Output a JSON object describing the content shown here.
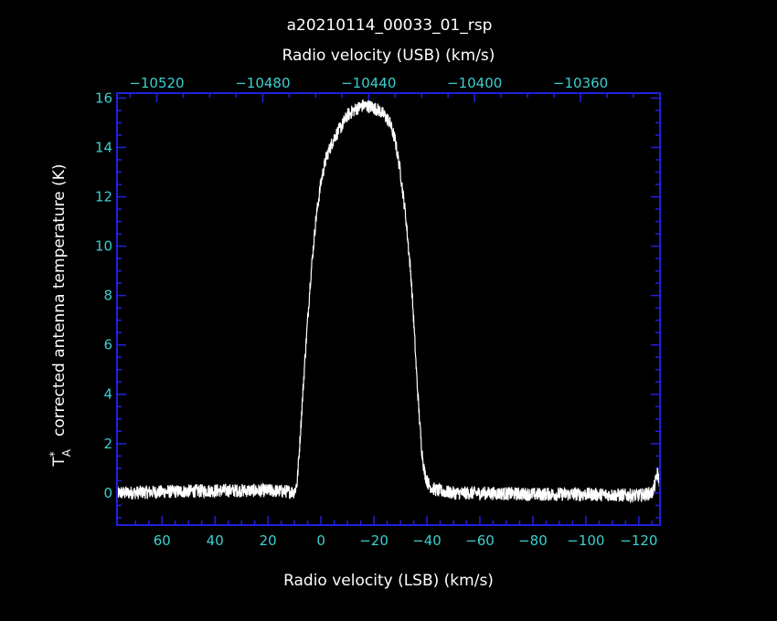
{
  "chart_data": {
    "type": "line",
    "title": "a20210114_00033_01_rsp",
    "top_axis_label": "Radio velocity (USB) (km/s)",
    "xlabel": "Radio velocity (LSB) (km/s)",
    "ylabel": "corrected antenna temperature (K)",
    "ylabel_symbol": "T",
    "ylabel_superscript": "*",
    "ylabel_subscript": "A",
    "xlim": [
      77,
      -128
    ],
    "ylim": [
      -1.3,
      16.2
    ],
    "top_xlim": [
      -10535,
      -10330
    ],
    "x_ticks": [
      60,
      40,
      20,
      0,
      -20,
      -40,
      -60,
      -80,
      -100,
      -120
    ],
    "x_tick_labels": [
      "60",
      "40",
      "20",
      "0",
      "−20",
      "−40",
      "−60",
      "−80",
      "−100",
      "−120"
    ],
    "top_x_ticks": [
      -10520,
      -10480,
      -10440,
      -10400,
      -10360
    ],
    "top_x_tick_labels": [
      "−10520",
      "−10480",
      "−10440",
      "−10400",
      "−10360"
    ],
    "y_ticks": [
      0,
      2,
      4,
      6,
      8,
      10,
      12,
      14,
      16
    ],
    "y_tick_labels": [
      "0",
      "2",
      "4",
      "6",
      "8",
      "10",
      "12",
      "14",
      "16"
    ],
    "grid": false,
    "series": [
      {
        "x": [
          77,
          60,
          40,
          20,
          10,
          9,
          8,
          6,
          4,
          2,
          0,
          -2,
          -5,
          -8,
          -10,
          -13,
          -16,
          -19,
          -22,
          -24,
          -26,
          -28,
          -30,
          -32,
          -34,
          -35,
          -36,
          -37,
          -38,
          -39,
          -40,
          -41,
          -42,
          -44,
          -50,
          -60,
          -80,
          -100,
          -120,
          -125,
          -126,
          -127,
          -128
        ],
        "y": [
          0.0,
          0.05,
          0.1,
          0.1,
          0.05,
          0.4,
          2.0,
          5.5,
          8.6,
          11.0,
          12.6,
          13.6,
          14.4,
          14.9,
          15.3,
          15.55,
          15.7,
          15.65,
          15.5,
          15.3,
          15.0,
          14.3,
          13.0,
          11.2,
          8.8,
          7.0,
          5.0,
          3.3,
          1.8,
          0.9,
          0.5,
          0.3,
          0.2,
          0.1,
          0.0,
          0.0,
          -0.05,
          -0.05,
          -0.1,
          0.0,
          0.3,
          0.8,
          0.4
        ],
        "color": "#ffffff"
      }
    ],
    "axis_color": "#2020e0",
    "tick_label_color": "#3ccfcf"
  }
}
